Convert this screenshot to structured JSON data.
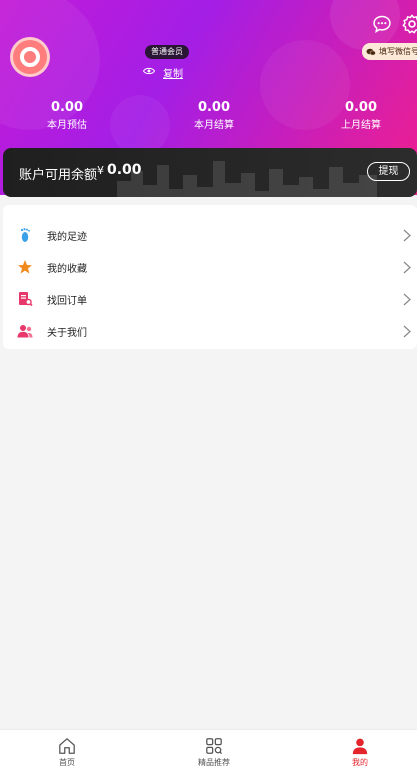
{
  "header": {
    "member_level": "普通会员",
    "copy_label": "复制",
    "wechat_tag": "填写微信号"
  },
  "stats": [
    {
      "value": "0.00",
      "label": "本月预估"
    },
    {
      "value": "0.00",
      "label": "本月结算"
    },
    {
      "value": "0.00",
      "label": "上月结算"
    }
  ],
  "balance": {
    "label": "账户可用余额",
    "currency": "¥",
    "amount": "0.00",
    "withdraw_label": "提现"
  },
  "menu": [
    {
      "label": "我的足迹",
      "icon": "footprint-icon",
      "color": "#3aa0e8"
    },
    {
      "label": "我的收藏",
      "icon": "star-icon",
      "color": "#f08a1c"
    },
    {
      "label": "找回订单",
      "icon": "order-search-icon",
      "color": "#e8386b"
    },
    {
      "label": "关于我们",
      "icon": "users-icon",
      "color": "#e8386b"
    }
  ],
  "tabbar": [
    {
      "label": "首页",
      "icon": "home-icon"
    },
    {
      "label": "精品推荐",
      "icon": "grid-icon"
    },
    {
      "label": "我的",
      "icon": "user-icon"
    }
  ],
  "colors": {
    "hero_start": "#c31bd6",
    "hero_end": "#ef1f8e",
    "active_tab": "#e4252d",
    "card_bg": "#1f1f1f"
  }
}
